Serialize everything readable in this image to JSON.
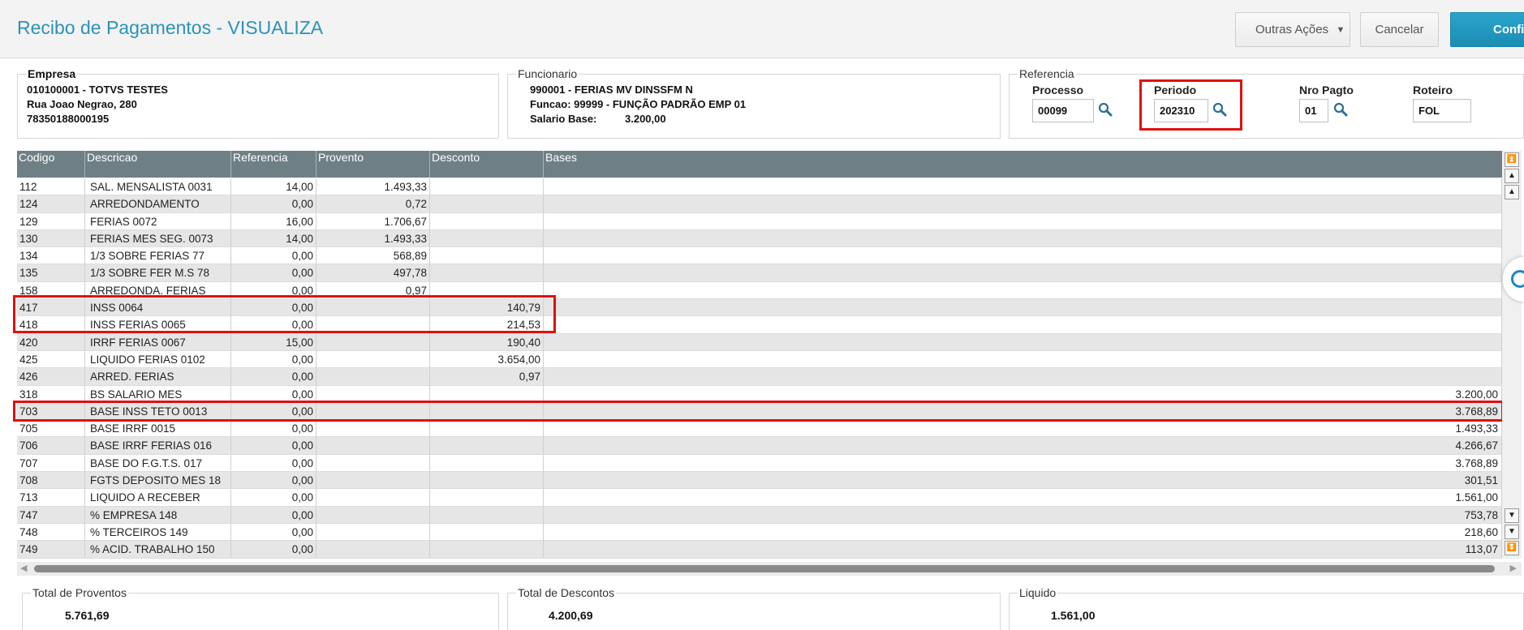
{
  "header": {
    "title": "Recibo de Pagamentos - VISUALIZA",
    "outras_acoes_label": "Outras Ações",
    "cancelar_label": "Cancelar",
    "confirmar_label": "Confirmar"
  },
  "empresa": {
    "legend": "Empresa",
    "line1": "010100001 - TOTVS TESTES",
    "line2": "Rua Joao Negrao, 280",
    "line3": "78350188000195"
  },
  "funcionario": {
    "legend": "Funcionario",
    "line1": "990001 - FERIAS MV DINSSFM N",
    "line2": "Funcao: 99999  - FUNÇÃO PADRÃO EMP 01",
    "salario_label": "Salario Base:",
    "salario_value": "3.200,00"
  },
  "referencia": {
    "legend": "Referencia",
    "processo_label": "Processo",
    "processo_value": "00099",
    "periodo_label": "Periodo",
    "periodo_value": "202310",
    "nro_pagto_label": "Nro Pagto",
    "nro_pagto_value": "01",
    "roteiro_label": "Roteiro",
    "roteiro_value": "FOL"
  },
  "grid": {
    "columns": [
      "Codigo",
      "Descricao",
      "Referencia",
      "Provento",
      "Desconto",
      "Bases"
    ],
    "rows": [
      {
        "cod": "112",
        "desc": "SAL. MENSALISTA 0031",
        "ref": "14,00",
        "prov": "1.493,33",
        "descto": "",
        "bases": ""
      },
      {
        "cod": "124",
        "desc": "ARREDONDAMENTO",
        "ref": "0,00",
        "prov": "0,72",
        "descto": "",
        "bases": ""
      },
      {
        "cod": "129",
        "desc": "FERIAS 0072",
        "ref": "16,00",
        "prov": "1.706,67",
        "descto": "",
        "bases": ""
      },
      {
        "cod": "130",
        "desc": "FERIAS MES SEG. 0073",
        "ref": "14,00",
        "prov": "1.493,33",
        "descto": "",
        "bases": ""
      },
      {
        "cod": "134",
        "desc": "1/3 SOBRE FERIAS 77",
        "ref": "0,00",
        "prov": "568,89",
        "descto": "",
        "bases": ""
      },
      {
        "cod": "135",
        "desc": "1/3 SOBRE FER M.S 78",
        "ref": "0,00",
        "prov": "497,78",
        "descto": "",
        "bases": ""
      },
      {
        "cod": "158",
        "desc": "ARREDONDA. FERIAS",
        "ref": "0,00",
        "prov": "0,97",
        "descto": "",
        "bases": ""
      },
      {
        "cod": "417",
        "desc": "INSS 0064",
        "ref": "0,00",
        "prov": "",
        "descto": "140,79",
        "bases": ""
      },
      {
        "cod": "418",
        "desc": "INSS FERIAS 0065",
        "ref": "0,00",
        "prov": "",
        "descto": "214,53",
        "bases": ""
      },
      {
        "cod": "420",
        "desc": "IRRF FERIAS 0067",
        "ref": "15,00",
        "prov": "",
        "descto": "190,40",
        "bases": ""
      },
      {
        "cod": "425",
        "desc": "LIQUIDO FERIAS 0102",
        "ref": "0,00",
        "prov": "",
        "descto": "3.654,00",
        "bases": ""
      },
      {
        "cod": "426",
        "desc": "ARRED. FERIAS",
        "ref": "0,00",
        "prov": "",
        "descto": "0,97",
        "bases": ""
      },
      {
        "cod": "318",
        "desc": "BS SALARIO MES",
        "ref": "0,00",
        "prov": "",
        "descto": "",
        "bases": "3.200,00"
      },
      {
        "cod": "703",
        "desc": "BASE INSS TETO 0013",
        "ref": "0,00",
        "prov": "",
        "descto": "",
        "bases": "3.768,89"
      },
      {
        "cod": "705",
        "desc": "BASE IRRF 0015",
        "ref": "0,00",
        "prov": "",
        "descto": "",
        "bases": "1.493,33"
      },
      {
        "cod": "706",
        "desc": "BASE IRRF FERIAS 016",
        "ref": "0,00",
        "prov": "",
        "descto": "",
        "bases": "4.266,67"
      },
      {
        "cod": "707",
        "desc": "BASE DO F.G.T.S. 017",
        "ref": "0,00",
        "prov": "",
        "descto": "",
        "bases": "3.768,89"
      },
      {
        "cod": "708",
        "desc": "FGTS DEPOSITO MES 18",
        "ref": "0,00",
        "prov": "",
        "descto": "",
        "bases": "301,51"
      },
      {
        "cod": "713",
        "desc": "LIQUIDO A RECEBER",
        "ref": "0,00",
        "prov": "",
        "descto": "",
        "bases": "1.561,00"
      },
      {
        "cod": "747",
        "desc": "% EMPRESA  148",
        "ref": "0,00",
        "prov": "",
        "descto": "",
        "bases": "753,78"
      },
      {
        "cod": "748",
        "desc": "% TERCEIROS 149",
        "ref": "0,00",
        "prov": "",
        "descto": "",
        "bases": "218,60"
      },
      {
        "cod": "749",
        "desc": "% ACID. TRABALHO 150",
        "ref": "0,00",
        "prov": "",
        "descto": "",
        "bases": "113,07"
      }
    ]
  },
  "totals": {
    "proventos_label": "Total de Proventos",
    "proventos_value": "5.761,69",
    "descontos_label": "Total de Descontos",
    "descontos_value": "4.200,69",
    "liquido_label": "Liquido",
    "liquido_value": "1.561,00"
  },
  "icons": {
    "search": "search-icon",
    "scroll_top": "scroll-top-icon",
    "page_up": "page-up-icon",
    "line_up": "line-up-icon",
    "line_down": "line-down-icon",
    "page_down": "page-down-icon",
    "scroll_bottom": "scroll-bottom-icon"
  },
  "colors": {
    "accent": "#2a93b8",
    "grid_header": "#6f7f86",
    "highlight": "#e01010"
  }
}
